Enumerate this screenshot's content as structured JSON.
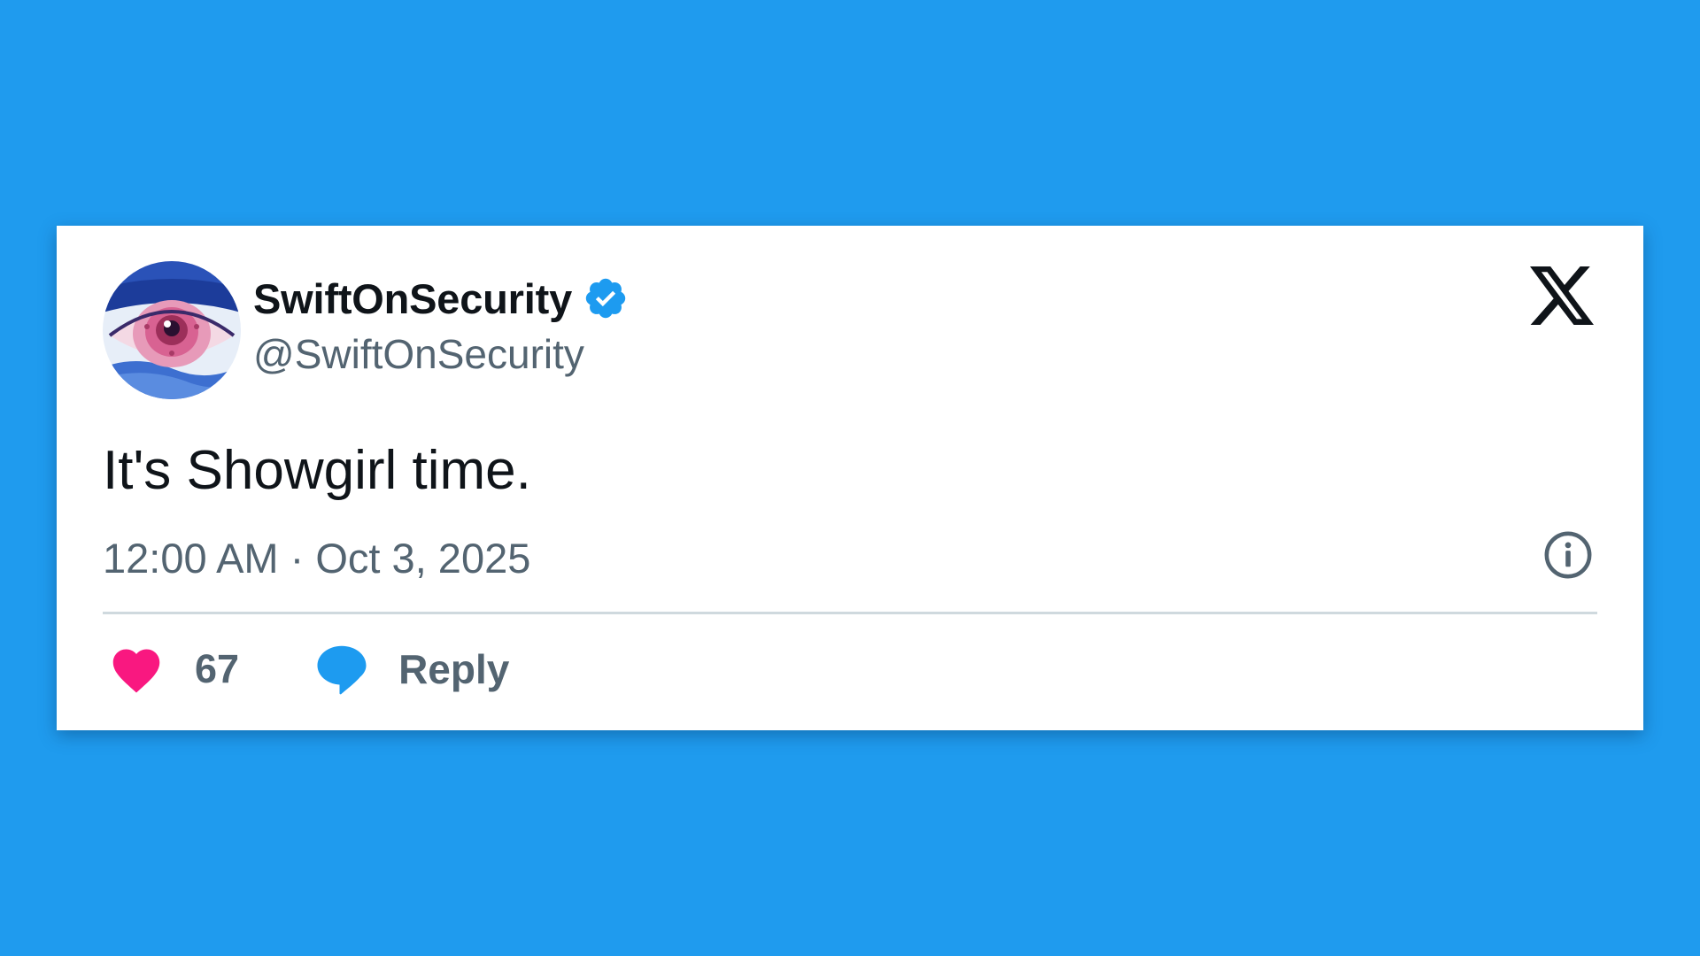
{
  "background_color": "#1f9bee",
  "tweet": {
    "display_name": "SwiftOnSecurity",
    "verified": true,
    "verified_icon": "verified-badge-icon",
    "handle": "@SwiftOnSecurity",
    "text": "It's Showgirl time.",
    "time": "12:00 AM",
    "separator": " · ",
    "date": "Oct 3, 2025",
    "like_count": "67",
    "reply_label": "Reply"
  },
  "icons": {
    "brand": "x-logo-icon",
    "info": "info-icon",
    "like": "heart-icon",
    "reply": "speech-bubble-icon"
  },
  "colors": {
    "accent": "#1d9bf0",
    "heart": "#f91880",
    "text_primary": "#0f1419",
    "text_secondary": "#536471",
    "divider": "#cfd9de"
  }
}
